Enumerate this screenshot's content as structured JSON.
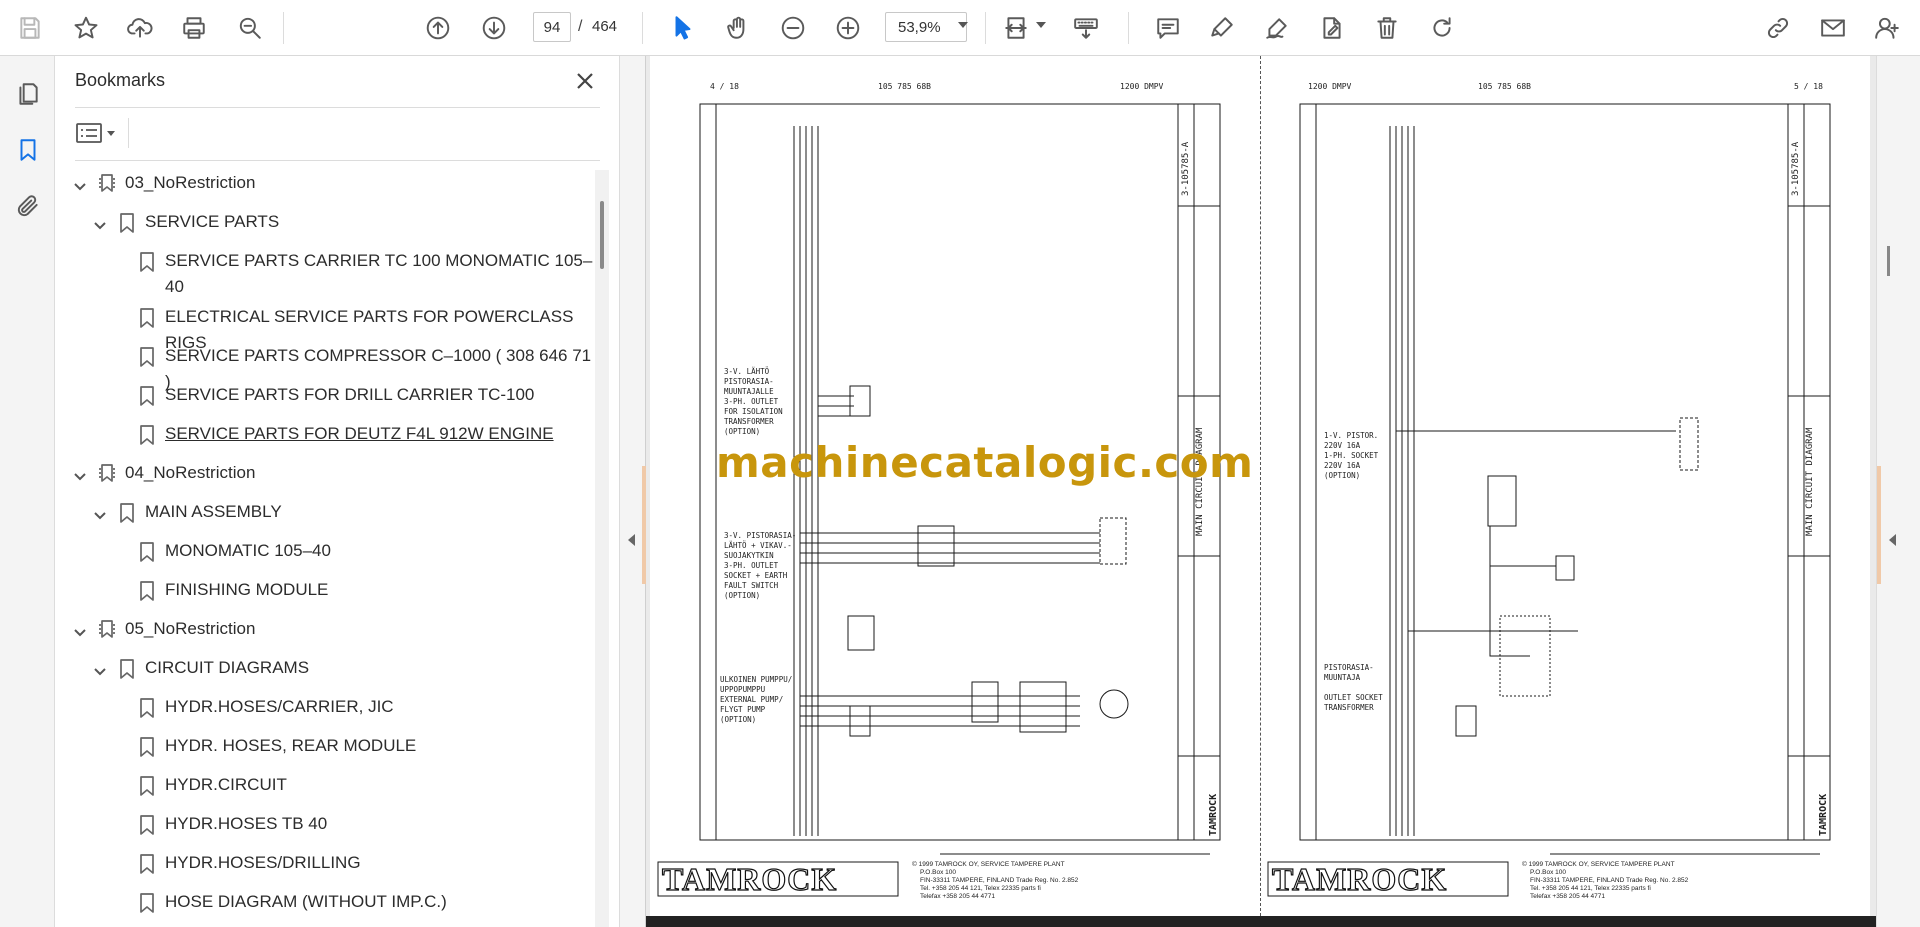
{
  "toolbar": {
    "icons": [
      "save-icon",
      "star-icon",
      "upload-icon",
      "print-icon",
      "zoom-search-icon",
      "arrow-up-circle-icon",
      "arrow-down-circle-icon",
      "pointer-icon",
      "hand-icon",
      "zoom-out-icon",
      "zoom-in-icon",
      "fit-page-icon",
      "keyboard-icon",
      "comment-icon",
      "highlighter-icon",
      "sign-icon",
      "edit-document-icon",
      "delete-icon",
      "rotate-icon",
      "share-link-icon",
      "email-icon",
      "user-icon"
    ],
    "current_page": "94",
    "page_separator": "/",
    "total_pages": "464",
    "zoom": "53,9%"
  },
  "panel": {
    "title": "Bookmarks"
  },
  "bookmarks": [
    {
      "label": "03_NoRestriction",
      "level": 0,
      "type": "group"
    },
    {
      "label": "SERVICE PARTS",
      "level": 1,
      "type": "folder"
    },
    {
      "label": "SERVICE PARTS CARRIER TC 100 MONOMATIC 105–",
      "label2": "40",
      "level": 2,
      "type": "leaf"
    },
    {
      "label": "ELECTRICAL SERVICE PARTS FOR POWERCLASS RIGS",
      "level": 2,
      "type": "leaf"
    },
    {
      "label": "SERVICE PARTS COMPRESSOR C–1000 ( 308 646 71 )",
      "level": 2,
      "type": "leaf"
    },
    {
      "label": "SERVICE PARTS FOR DRILL CARRIER TC-100",
      "level": 2,
      "type": "leaf"
    },
    {
      "label": "SERVICE PARTS FOR DEUTZ F4L 912W ENGINE",
      "level": 2,
      "type": "leaf",
      "underline": true
    },
    {
      "label": "04_NoRestriction",
      "level": 0,
      "type": "group"
    },
    {
      "label": "MAIN ASSEMBLY",
      "level": 1,
      "type": "folder"
    },
    {
      "label": "MONOMATIC 105–40",
      "level": 2,
      "type": "leaf"
    },
    {
      "label": "FINISHING MODULE",
      "level": 2,
      "type": "leaf"
    },
    {
      "label": "05_NoRestriction",
      "level": 0,
      "type": "group"
    },
    {
      "label": "CIRCUIT DIAGRAMS",
      "level": 1,
      "type": "folder"
    },
    {
      "label": "HYDR.HOSES/CARRIER, JIC",
      "level": 2,
      "type": "leaf"
    },
    {
      "label": "HYDR. HOSES, REAR MODULE",
      "level": 2,
      "type": "leaf"
    },
    {
      "label": "HYDR.CIRCUIT",
      "level": 2,
      "type": "leaf"
    },
    {
      "label": "HYDR.HOSES TB 40",
      "level": 2,
      "type": "leaf"
    },
    {
      "label": "HYDR.HOSES/DRILLING",
      "level": 2,
      "type": "leaf"
    },
    {
      "label": "HOSE DIAGRAM (WITHOUT IMP.C.)",
      "level": 2,
      "type": "leaf"
    }
  ],
  "document": {
    "watermark": "machinecatalogic.com",
    "left_page": {
      "sheet": "4 / 18",
      "doc_no": "105 785 68B",
      "model": "1200 DMPV",
      "label_a": [
        "3-V. LÄHTÖ",
        "PISTORASIA-",
        "MUUNTAJALLE",
        "3-PH. OUTLET",
        "FOR ISOLATION",
        "TRANSFORMER",
        "(OPTION)"
      ],
      "label_b": [
        "3-V. PISTORASIA-",
        "LÄHTÖ + VIKAV.-",
        "SUOJAKYTKIN",
        "3-PH. OUTLET",
        "SOCKET + EARTH",
        "FAULT SWITCH",
        "(OPTION)"
      ],
      "label_c": [
        "ULKOINEN PUMPPU/",
        "UPPOPUMPPU",
        "EXTERNAL PUMP/",
        "FLYGT PUMP",
        "(OPTION)"
      ],
      "title_block": "MAIN CIRCUIT DIAGRAM",
      "drawing_no": "3-105785-A",
      "brand": "TAMROCK",
      "footer": [
        "© 1999 TAMROCK OY, SERVICE TAMPERE PLANT",
        "P.O.Box 100",
        "FIN-33311 TAMPERE, FINLAND  Trade Reg. No. 2.852",
        "Tel. +358 205 44 121, Telex 22335 parts fi",
        "Telefax +358 205 44 4771"
      ]
    },
    "right_page": {
      "sheet": "5 / 18",
      "doc_no": "105 785 68B",
      "model": "1200 DMPV",
      "label_a": [
        "1-V. PISTOR.",
        "220V 16A",
        "1-PH. SOCKET",
        "220V 16A",
        "(OPTION)"
      ],
      "label_b": [
        "PISTORASIA-",
        "MUUNTAJA",
        "",
        "OUTLET SOCKET",
        "TRANSFORMER"
      ],
      "title_block": "MAIN CIRCUIT DIAGRAM",
      "drawing_no": "3-105785-A",
      "brand": "TAMROCK",
      "footer": [
        "© 1999 TAMROCK OY, SERVICE TAMPERE PLANT",
        "P.O.Box 100",
        "FIN-33311 TAMPERE, FINLAND  Trade Reg. No. 2.852",
        "Tel. +358 205 44 121, Telex 22335 parts fi",
        "Telefax +358 205 44 4771"
      ]
    }
  }
}
